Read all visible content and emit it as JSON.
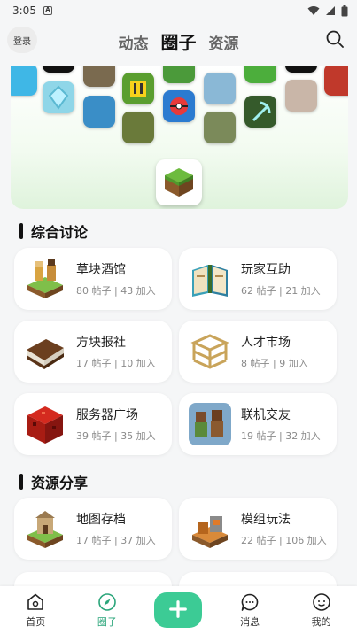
{
  "status_bar": {
    "time": "3:05",
    "sim_label": "A"
  },
  "header": {
    "login_label": "登录",
    "tabs": [
      {
        "label": "动态",
        "active": false
      },
      {
        "label": "圈子",
        "active": true
      },
      {
        "label": "资源",
        "active": false
      }
    ],
    "search_icon": "search-icon"
  },
  "banner": {
    "center_icon": "grass-block-icon"
  },
  "sections": [
    {
      "title": "综合讨论",
      "cards": [
        {
          "title": "草块酒馆",
          "stats": "80 帖子 | 43 加入",
          "icon": "tavern-icon"
        },
        {
          "title": "玩家互助",
          "stats": "62 帖子 | 21 加入",
          "icon": "book-icon"
        },
        {
          "title": "方块报社",
          "stats": "17 帖子 | 10 加入",
          "icon": "newspaper-book-icon"
        },
        {
          "title": "人才市场",
          "stats": "8 帖子 | 9 加入",
          "icon": "scaffold-icon"
        },
        {
          "title": "服务器广场",
          "stats": "39 帖子 | 35 加入",
          "icon": "redstone-block-icon"
        },
        {
          "title": "联机交友",
          "stats": "19 帖子 | 32 加入",
          "icon": "players-icon"
        }
      ]
    },
    {
      "title": "资源分享",
      "cards": [
        {
          "title": "地图存档",
          "stats": "17 帖子 | 37 加入",
          "icon": "map-island-icon"
        },
        {
          "title": "模组玩法",
          "stats": "22 帖子 | 106 加入",
          "icon": "mod-island-icon"
        }
      ]
    }
  ],
  "bottom_nav": [
    {
      "label": "首页",
      "icon": "home-icon",
      "active": false
    },
    {
      "label": "圈子",
      "icon": "compass-icon",
      "active": true
    },
    {
      "label": "",
      "icon": "add-icon",
      "active": false
    },
    {
      "label": "消息",
      "icon": "message-icon",
      "active": false
    },
    {
      "label": "我的",
      "icon": "profile-icon",
      "active": false
    }
  ],
  "colors": {
    "accent": "#3ccb95",
    "active_nav": "#2aa57a",
    "background": "#f5f6f7"
  }
}
